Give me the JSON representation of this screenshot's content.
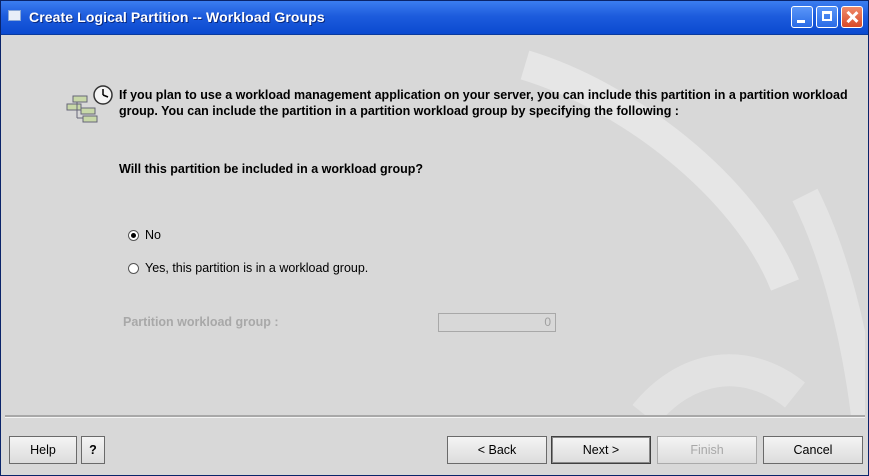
{
  "window": {
    "title": "Create Logical Partition -- Workload Groups",
    "icon": "window-app-icon",
    "controls": [
      "minimize-icon",
      "maximize-icon",
      "close-icon"
    ]
  },
  "intro": {
    "icon": "workload-group-icon",
    "text": "If you plan to use a workload management application on your server, you can include this partition in a  partition workload group.  You can include the partition in a partition workload group by specifying the following :"
  },
  "question": "Will this partition be included in a workload group?",
  "options": {
    "no": {
      "label": "No",
      "selected": true
    },
    "yes": {
      "label": "Yes, this partition is in a workload group.",
      "selected": false
    }
  },
  "partition_workload_group": {
    "label": "Partition workload group :",
    "value": "0",
    "enabled": false
  },
  "buttons": {
    "help": "Help",
    "help_question": "?",
    "back": "< Back",
    "next": "Next >",
    "finish": "Finish",
    "cancel": "Cancel"
  },
  "colors": {
    "titlebar": "#1d5cdd",
    "background": "#d8d8d8",
    "disabled_text": "#a8a8a8"
  }
}
